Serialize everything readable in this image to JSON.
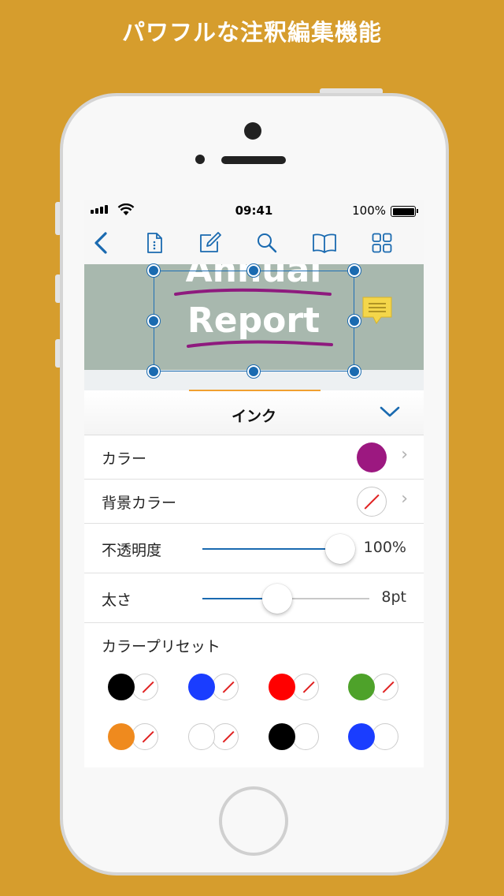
{
  "headline": "パワフルな注釈編集機能",
  "status_bar": {
    "time": "09:41",
    "battery": "100%"
  },
  "toolbar": {
    "icons": [
      "back-chevron-icon",
      "document-info-icon",
      "edit-icon",
      "search-icon",
      "book-icon",
      "grid-icon"
    ]
  },
  "document": {
    "title_line1": "Annual",
    "title_line2": "Report"
  },
  "panel": {
    "title": "インク",
    "color_label": "カラー",
    "color_value": "#9C1880",
    "bg_color_label": "背景カラー",
    "opacity_label": "不透明度",
    "opacity_value": "100%",
    "opacity_level": 1.0,
    "thickness_label": "太さ",
    "thickness_value": "8pt",
    "thickness_level": 0.45,
    "presets_label": "カラープリセット",
    "presets": [
      {
        "pen": "#000000",
        "bg": "none"
      },
      {
        "pen": "#1A3DFF",
        "bg": "none"
      },
      {
        "pen": "#FF0000",
        "bg": "none"
      },
      {
        "pen": "#4EA22A",
        "bg": "none"
      },
      {
        "pen": "#EF8A1E",
        "bg": "none"
      },
      {
        "pen": "#FFFFFF",
        "bg": "none"
      },
      {
        "pen": "#000000",
        "bg": "#FFFFFF"
      },
      {
        "pen": "#1A3DFF",
        "bg": "#FFFFFF"
      }
    ]
  },
  "colors": {
    "accent": "#1A6AB0",
    "background": "#D69D2D",
    "underline": "#8E1A7E"
  }
}
